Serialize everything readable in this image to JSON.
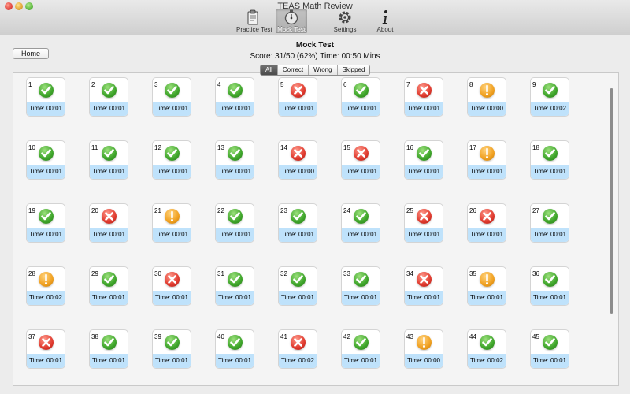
{
  "window": {
    "title": "TEAS Math Review"
  },
  "toolbar": {
    "items": [
      {
        "label": "Practice Test",
        "icon": "clipboard-icon"
      },
      {
        "label": "Mock Test",
        "icon": "stopwatch-icon",
        "active": true
      },
      {
        "label": "Settings",
        "icon": "gear-icon"
      },
      {
        "label": "About",
        "icon": "info-icon"
      }
    ]
  },
  "header": {
    "home_label": "Home",
    "title": "Mock Test",
    "score": "Score: 31/50 (62%) Time: 00:50 Mins"
  },
  "filters": [
    "All",
    "Correct",
    "Wrong",
    "Skipped"
  ],
  "selected_filter": "All",
  "colors": {
    "correct": "#3ea52a",
    "wrong": "#e03a2e",
    "skipped": "#f0a020",
    "timebar": "#bfe2fb"
  },
  "questions": [
    {
      "num": "1",
      "status": "correct",
      "time": "Time: 00:01"
    },
    {
      "num": "2",
      "status": "correct",
      "time": "Time: 00:01"
    },
    {
      "num": "3",
      "status": "correct",
      "time": "Time: 00:01"
    },
    {
      "num": "4",
      "status": "correct",
      "time": "Time: 00:01"
    },
    {
      "num": "5",
      "status": "wrong",
      "time": "Time: 00:01"
    },
    {
      "num": "6",
      "status": "correct",
      "time": "Time: 00:01"
    },
    {
      "num": "7",
      "status": "wrong",
      "time": "Time: 00:01"
    },
    {
      "num": "8",
      "status": "skipped",
      "time": "Time: 00:00"
    },
    {
      "num": "9",
      "status": "correct",
      "time": "Time: 00:02"
    },
    {
      "num": "10",
      "status": "correct",
      "time": "Time: 00:01"
    },
    {
      "num": "11",
      "status": "correct",
      "time": "Time: 00:01"
    },
    {
      "num": "12",
      "status": "correct",
      "time": "Time: 00:01"
    },
    {
      "num": "13",
      "status": "correct",
      "time": "Time: 00:01"
    },
    {
      "num": "14",
      "status": "wrong",
      "time": "Time: 00:00"
    },
    {
      "num": "15",
      "status": "wrong",
      "time": "Time: 00:01"
    },
    {
      "num": "16",
      "status": "correct",
      "time": "Time: 00:01"
    },
    {
      "num": "17",
      "status": "skipped",
      "time": "Time: 00:01"
    },
    {
      "num": "18",
      "status": "correct",
      "time": "Time: 00:01"
    },
    {
      "num": "19",
      "status": "correct",
      "time": "Time: 00:01"
    },
    {
      "num": "20",
      "status": "wrong",
      "time": "Time: 00:01"
    },
    {
      "num": "21",
      "status": "skipped",
      "time": "Time: 00:01"
    },
    {
      "num": "22",
      "status": "correct",
      "time": "Time: 00:01"
    },
    {
      "num": "23",
      "status": "correct",
      "time": "Time: 00:01"
    },
    {
      "num": "24",
      "status": "correct",
      "time": "Time: 00:01"
    },
    {
      "num": "25",
      "status": "wrong",
      "time": "Time: 00:01"
    },
    {
      "num": "26",
      "status": "wrong",
      "time": "Time: 00:01"
    },
    {
      "num": "27",
      "status": "correct",
      "time": "Time: 00:01"
    },
    {
      "num": "28",
      "status": "skipped",
      "time": "Time: 00:02"
    },
    {
      "num": "29",
      "status": "correct",
      "time": "Time: 00:01"
    },
    {
      "num": "30",
      "status": "wrong",
      "time": "Time: 00:01"
    },
    {
      "num": "31",
      "status": "correct",
      "time": "Time: 00:01"
    },
    {
      "num": "32",
      "status": "correct",
      "time": "Time: 00:01"
    },
    {
      "num": "33",
      "status": "correct",
      "time": "Time: 00:01"
    },
    {
      "num": "34",
      "status": "wrong",
      "time": "Time: 00:01"
    },
    {
      "num": "35",
      "status": "skipped",
      "time": "Time: 00:01"
    },
    {
      "num": "36",
      "status": "correct",
      "time": "Time: 00:01"
    },
    {
      "num": "37",
      "status": "wrong",
      "time": "Time: 00:01"
    },
    {
      "num": "38",
      "status": "correct",
      "time": "Time: 00:01"
    },
    {
      "num": "39",
      "status": "correct",
      "time": "Time: 00:01"
    },
    {
      "num": "40",
      "status": "correct",
      "time": "Time: 00:01"
    },
    {
      "num": "41",
      "status": "wrong",
      "time": "Time: 00:02"
    },
    {
      "num": "42",
      "status": "correct",
      "time": "Time: 00:01"
    },
    {
      "num": "43",
      "status": "skipped",
      "time": "Time: 00:00"
    },
    {
      "num": "44",
      "status": "correct",
      "time": "Time: 00:02"
    },
    {
      "num": "45",
      "status": "correct",
      "time": "Time: 00:01"
    }
  ]
}
